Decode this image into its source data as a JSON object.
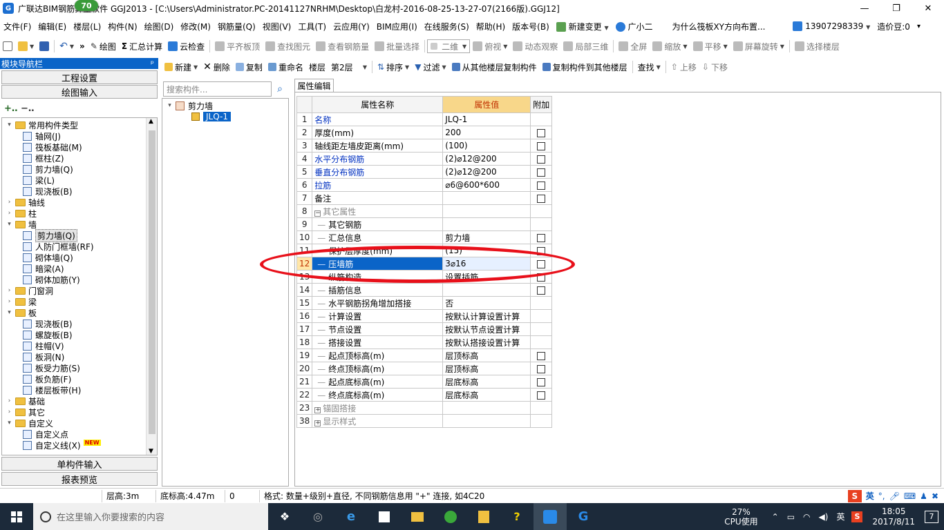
{
  "window": {
    "app_icon_text": "G",
    "title": "广联达BIM钢筋算量软件 GGJ2013 - [C:\\Users\\Administrator.PC-20141127NRHM\\Desktop\\白龙村-2016-08-25-13-27-07(2166版).GGJ12]",
    "badge": "70",
    "minimize": "—",
    "restore": "❐",
    "close": "✕"
  },
  "menu": {
    "items": [
      "文件(F)",
      "编辑(E)",
      "楼层(L)",
      "构件(N)",
      "绘图(D)",
      "修改(M)",
      "钢筋量(Q)",
      "视图(V)",
      "工具(T)",
      "云应用(Y)",
      "BIM应用(I)",
      "在线服务(S)",
      "帮助(H)",
      "版本号(B)"
    ],
    "new_change": "新建变更",
    "assistant": "广小二",
    "question": "为什么筏板XY方向布置...",
    "phone": "13907298339",
    "beans": "造价豆:0"
  },
  "toolbar1": {
    "draw": "绘图",
    "sum_calc": "汇总计算",
    "cloud_check": "云检查",
    "align_top": "平齐板顶",
    "find_element": "查找图元",
    "view_rebar": "查看钢筋量",
    "batch_select": "批量选择",
    "view_mode": "二维",
    "top_view": "俯视",
    "dynamic_view": "动态观察",
    "local_3d": "局部三维",
    "fullscreen": "全屏",
    "zoom": "缩放",
    "pan": "平移",
    "rotate": "屏幕旋转",
    "select_floor": "选择楼层"
  },
  "nav": {
    "title": "模块导航栏",
    "pin": "ᵖ",
    "close": "×",
    "project_settings": "工程设置",
    "drawing_input": "绘图输入",
    "single_input": "单构件输入",
    "report_preview": "报表预览",
    "tree": [
      {
        "level": 0,
        "exp": "▾",
        "folder": true,
        "label": "常用构件类型"
      },
      {
        "level": 1,
        "label": "轴网(J)"
      },
      {
        "level": 1,
        "label": "筏板基础(M)"
      },
      {
        "level": 1,
        "label": "框柱(Z)"
      },
      {
        "level": 1,
        "label": "剪力墙(Q)"
      },
      {
        "level": 1,
        "label": "梁(L)"
      },
      {
        "level": 1,
        "label": "现浇板(B)"
      },
      {
        "level": 0,
        "exp": "›",
        "folder": true,
        "label": "轴线"
      },
      {
        "level": 0,
        "exp": "›",
        "folder": true,
        "label": "柱"
      },
      {
        "level": 0,
        "exp": "▾",
        "folder": true,
        "label": "墙"
      },
      {
        "level": 1,
        "label": "剪力墙(Q)",
        "selected": true
      },
      {
        "level": 1,
        "label": "人防门框墙(RF)"
      },
      {
        "level": 1,
        "label": "砌体墙(Q)"
      },
      {
        "level": 1,
        "label": "暗梁(A)"
      },
      {
        "level": 1,
        "label": "砌体加筋(Y)"
      },
      {
        "level": 0,
        "exp": "›",
        "folder": true,
        "label": "门窗洞"
      },
      {
        "level": 0,
        "exp": "›",
        "folder": true,
        "label": "梁"
      },
      {
        "level": 0,
        "exp": "▾",
        "folder": true,
        "label": "板"
      },
      {
        "level": 1,
        "label": "现浇板(B)"
      },
      {
        "level": 1,
        "label": "螺旋板(B)"
      },
      {
        "level": 1,
        "label": "柱帽(V)"
      },
      {
        "level": 1,
        "label": "板洞(N)"
      },
      {
        "level": 1,
        "label": "板受力筋(S)"
      },
      {
        "level": 1,
        "label": "板负筋(F)"
      },
      {
        "level": 1,
        "label": "楼层板带(H)"
      },
      {
        "level": 0,
        "exp": "›",
        "folder": true,
        "label": "基础"
      },
      {
        "level": 0,
        "exp": "›",
        "folder": true,
        "label": "其它"
      },
      {
        "level": 0,
        "exp": "▾",
        "folder": true,
        "label": "自定义"
      },
      {
        "level": 1,
        "label": "自定义点"
      },
      {
        "level": 1,
        "label": "自定义线(X)",
        "new": "NEW"
      }
    ]
  },
  "toolbar2": {
    "new": "新建",
    "delete": "删除",
    "copy": "复制",
    "rename": "重命名",
    "floor_label": "楼层",
    "floor_value": "第2层",
    "sort": "排序",
    "filter": "过滤",
    "copy_from_floor": "从其他楼层复制构件",
    "copy_to_floor": "复制构件到其他楼层",
    "find": "查找",
    "move_up": "上移",
    "move_down": "下移"
  },
  "component_list": {
    "search_placeholder": "搜索构件...",
    "parent": "剪力墙",
    "child": "JLQ-1"
  },
  "properties": {
    "tab": "属性编辑",
    "headers": {
      "name": "属性名称",
      "value": "属性值",
      "extra": "附加"
    },
    "rows": [
      {
        "n": "1",
        "name": "名称",
        "value": "JLQ-1",
        "blue": true,
        "chk": false
      },
      {
        "n": "2",
        "name": "厚度(mm)",
        "value": "200",
        "chk": true
      },
      {
        "n": "3",
        "name": "轴线距左墙皮距离(mm)",
        "value": "(100)",
        "chk": true
      },
      {
        "n": "4",
        "name": "水平分布钢筋",
        "value": "(2)⌀12@200",
        "blue": true,
        "chk": true
      },
      {
        "n": "5",
        "name": "垂直分布钢筋",
        "value": "(2)⌀12@200",
        "blue": true,
        "chk": true
      },
      {
        "n": "6",
        "name": "拉筋",
        "value": "⌀6@600*600",
        "blue": true,
        "chk": true
      },
      {
        "n": "7",
        "name": "备注",
        "value": "",
        "chk": true
      },
      {
        "n": "8",
        "name": "其它属性",
        "value": "",
        "gray": true,
        "group": "minus"
      },
      {
        "n": "9",
        "name": "其它钢筋",
        "value": "",
        "sub": true
      },
      {
        "n": "10",
        "name": "汇总信息",
        "value": "剪力墙",
        "sub": true,
        "chk": true
      },
      {
        "n": "11",
        "name": "保护层厚度(mm)",
        "value": "(15)",
        "sub": true,
        "chk": true
      },
      {
        "n": "12",
        "name": "压墙筋",
        "value": "3⌀16",
        "sub": true,
        "chk": true,
        "selected": true
      },
      {
        "n": "13",
        "name": "纵筋构造",
        "value": "设置插筋",
        "sub": true,
        "chk": true
      },
      {
        "n": "14",
        "name": "插筋信息",
        "value": "",
        "sub": true,
        "chk": true
      },
      {
        "n": "15",
        "name": "水平钢筋拐角增加搭接",
        "value": "否",
        "sub": true
      },
      {
        "n": "16",
        "name": "计算设置",
        "value": "按默认计算设置计算",
        "sub": true
      },
      {
        "n": "17",
        "name": "节点设置",
        "value": "按默认节点设置计算",
        "sub": true
      },
      {
        "n": "18",
        "name": "搭接设置",
        "value": "按默认搭接设置计算",
        "sub": true
      },
      {
        "n": "19",
        "name": "起点顶标高(m)",
        "value": "层顶标高",
        "sub": true,
        "chk": true
      },
      {
        "n": "20",
        "name": "终点顶标高(m)",
        "value": "层顶标高",
        "sub": true,
        "chk": true
      },
      {
        "n": "21",
        "name": "起点底标高(m)",
        "value": "层底标高",
        "sub": true,
        "chk": true
      },
      {
        "n": "22",
        "name": "终点底标高(m)",
        "value": "层底标高",
        "sub": true,
        "chk": true
      },
      {
        "n": "23",
        "name": "锚固搭接",
        "value": "",
        "gray": true,
        "group": "plus"
      },
      {
        "n": "38",
        "name": "显示样式",
        "value": "",
        "gray": true,
        "group": "plus"
      }
    ]
  },
  "status": {
    "floor_height": "层高:3m",
    "base_elev": "底标高:4.47m",
    "zero": "0",
    "hint": "格式: 数量+级别+直径, 不同钢筋信息用 \"+\" 连接, 如4C20"
  },
  "ime": {
    "lang": "英",
    "logo": "S"
  },
  "taskbar": {
    "search_placeholder": "在这里输入你要搜索的内容",
    "cpu_percent": "27%",
    "cpu_label": "CPU使用",
    "ime": "英",
    "time": "18:05",
    "date": "2017/8/11",
    "notify": "7"
  }
}
